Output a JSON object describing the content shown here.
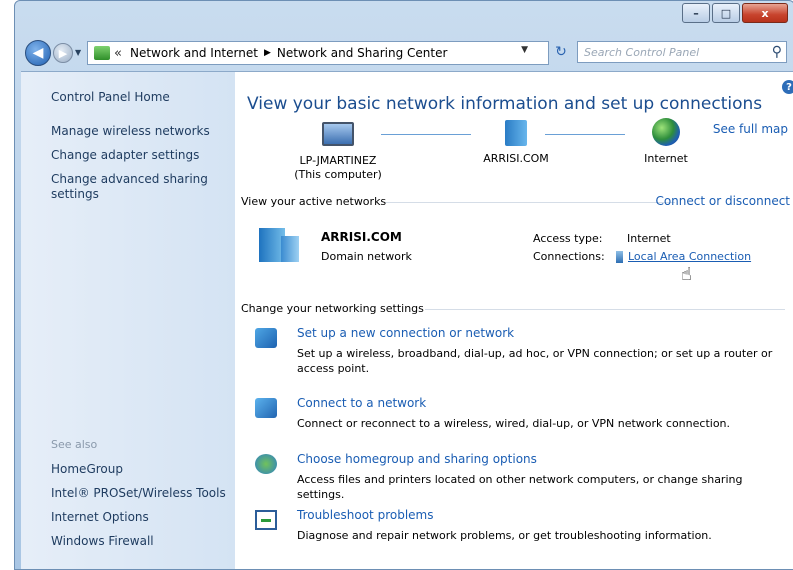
{
  "window": {
    "minimize_glyph": "–",
    "maximize_glyph": "□",
    "close_glyph": "x"
  },
  "nav": {
    "back_glyph": "◀",
    "forward_glyph": "▶",
    "history_glyph": "▼",
    "address": {
      "prefix": "«",
      "crumbs": [
        "Network and Internet",
        "Network and Sharing Center"
      ],
      "separator": "▶",
      "dropdown_glyph": "▼"
    },
    "refresh_glyph": "↻",
    "search_placeholder": "Search Control Panel",
    "search_icon_glyph": "⚲"
  },
  "sidebar": {
    "home": "Control Panel Home",
    "links": [
      "Manage wireless networks",
      "Change adapter settings",
      "Change advanced sharing settings"
    ],
    "see_also_label": "See also",
    "see_also": [
      "HomeGroup",
      "Intel® PROSet/Wireless Tools",
      "Internet Options",
      "Windows Firewall"
    ]
  },
  "main": {
    "help_glyph": "?",
    "title": "View your basic network information and set up connections",
    "see_full_map": "See full map",
    "map": {
      "computer_name": "LP-JMARTINEZ",
      "computer_sub": "(This computer)",
      "domain": "ARRISI.COM",
      "internet": "Internet"
    },
    "active_networks": {
      "heading": "View your active networks",
      "connect_disconnect": "Connect or disconnect",
      "network_name": "ARRISI.COM",
      "network_type": "Domain network",
      "access_type_label": "Access type:",
      "access_type_value": "Internet",
      "connections_label": "Connections:",
      "connections_value": "Local Area Connection"
    },
    "settings": {
      "heading": "Change your networking settings",
      "tasks": [
        {
          "title": "Set up a new connection or network",
          "desc": "Set up a wireless, broadband, dial-up, ad hoc, or VPN connection; or set up a router or access point."
        },
        {
          "title": "Connect to a network",
          "desc": "Connect or reconnect to a wireless, wired, dial-up, or VPN network connection."
        },
        {
          "title": "Choose homegroup and sharing options",
          "desc": "Access files and printers located on other network computers, or change sharing settings."
        },
        {
          "title": "Troubleshoot problems",
          "desc": "Diagnose and repair network problems, or get troubleshooting information."
        }
      ]
    }
  },
  "cursor_glyph": "☝",
  "colors": {
    "link": "#1a5db3",
    "title": "#1b4d8f",
    "sidebar_text": "#1e3b5f"
  }
}
